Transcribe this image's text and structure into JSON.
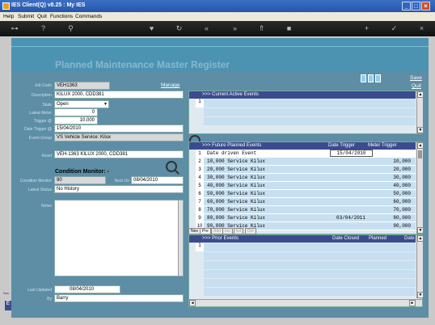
{
  "window": {
    "title": "IES Client(Q) v8.25 : My IES"
  },
  "menu": [
    "Help",
    "Submit",
    "Quit",
    "Functions",
    "Commands"
  ],
  "page": {
    "title": "Planned Maintenance Master Register",
    "save": "Save",
    "quit": "Quit",
    "manage": "Manage"
  },
  "form": {
    "job_code": {
      "label": "Job Code",
      "value": "VEH1363"
    },
    "description": {
      "label": "Description",
      "value": "KILUX 2000, CDD381"
    },
    "state": {
      "label": "State",
      "value": "Open"
    },
    "latest_meter": {
      "label": "Latest Meter",
      "value": "0"
    },
    "trigger": {
      "label": "Trigger @",
      "value": "10,000"
    },
    "date_trigger": {
      "label": "Date Trigger @",
      "value": "15/04/2010"
    },
    "event_group": {
      "label": "Event Group",
      "value": "VS Vehicle Service: Kilux"
    },
    "asset": {
      "label": "Asset",
      "value": "VEH-1363 KILUX 2000, CDD381"
    },
    "condition_title": "Condition Monitor: -",
    "condition_monitor": {
      "label": "Condition Monitor",
      "value": "90"
    },
    "next_on": {
      "label": "Next On",
      "value": "08/04/2010"
    },
    "latest_status": {
      "label": "Latest Status",
      "value": "No History"
    },
    "notes": {
      "label": "Notes",
      "value": ""
    },
    "last_updated": {
      "label": "Last Updated",
      "value": "08/04/2010"
    },
    "by": {
      "label": "By",
      "value": "Barry"
    }
  },
  "current_events": {
    "title": ">>> Current Active Events",
    "rows": [
      "1"
    ]
  },
  "future_events": {
    "title": ">>> Future Planned Events",
    "col_date": "Date Trigger",
    "col_meter": "Meter Trigger",
    "rows": [
      {
        "n": "1",
        "desc": "Date driven Event",
        "date": "15/04/2010",
        "meter": ""
      },
      {
        "n": "2",
        "desc": "10,000 Service Kilux",
        "date": "",
        "meter": "10,000"
      },
      {
        "n": "3",
        "desc": "20,000 Service Kilux",
        "date": "",
        "meter": "20,000"
      },
      {
        "n": "4",
        "desc": "30,000 Service Kilux",
        "date": "",
        "meter": "30,000"
      },
      {
        "n": "5",
        "desc": "40,000 Service Kilux",
        "date": "",
        "meter": "40,000"
      },
      {
        "n": "6",
        "desc": "50,000 Service Kilux",
        "date": "",
        "meter": "50,000"
      },
      {
        "n": "7",
        "desc": "60,000 Service Kilux",
        "date": "",
        "meter": "60,000"
      },
      {
        "n": "8",
        "desc": "70,000 Service Kilux",
        "date": "",
        "meter": "70,000"
      },
      {
        "n": "9",
        "desc": "80,000 Service Kilux",
        "date": "03/04/2011",
        "meter": "80,000"
      },
      {
        "n": "10",
        "desc": "90,000 Service Kilux",
        "date": "",
        "meter": "90,000"
      }
    ],
    "tabs": [
      "Nex",
      "Pre",
      "Add",
      "Ins",
      "Ed",
      "Del"
    ]
  },
  "prior_events": {
    "title": ">>> Prior Events",
    "col_closed": "Date Closed",
    "col_planned": "Planned",
    "col_date": "Date",
    "rows": [
      "1"
    ]
  },
  "colors": {
    "title_bar": "#2556a8",
    "canvas": "#5d8ea6",
    "panel_header": "#3a4c8f"
  }
}
